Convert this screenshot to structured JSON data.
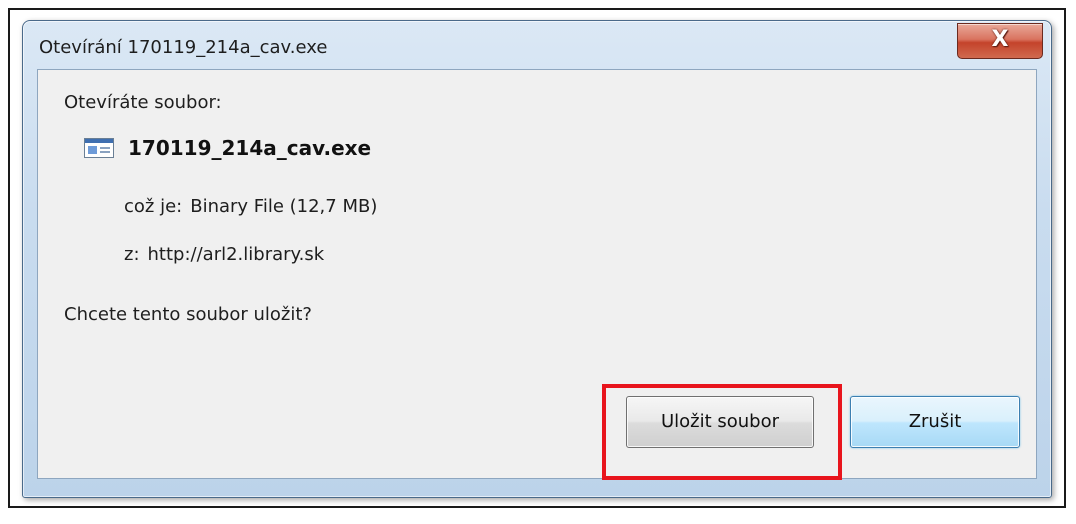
{
  "window": {
    "title": "Otevírání 170119_214a_cav.exe",
    "close_symbol": "X"
  },
  "dialog": {
    "prompt": "Otevíráte soubor:",
    "file_icon": "exe-file-icon",
    "file_name": "170119_214a_cav.exe",
    "type_label": "což je:",
    "type_value": "Binary File (12,7 MB)",
    "from_label": "z:",
    "from_value": "http://arl2.library.sk",
    "question": "Chcete tento soubor uložit?"
  },
  "buttons": {
    "save": "Uložit soubor",
    "cancel": "Zrušit"
  },
  "annotation": {
    "highlight_color": "#e8141c",
    "highlighted": "save-button"
  }
}
